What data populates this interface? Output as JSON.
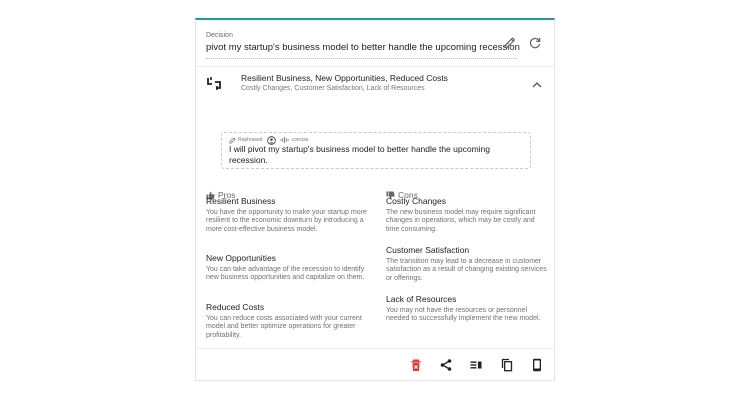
{
  "decision": {
    "label": "Decision",
    "value": "pivot my startup's business model to better handle the upcoming recession"
  },
  "summary": {
    "title": "Resilient Business, New Opportunities, Reduced Costs",
    "subtitle": "Costly Changes, Customer Satisfaction, Lack of Resources"
  },
  "rephrased": {
    "tag": "Rephrased",
    "style": "concise",
    "text": "I will pivot my startup's business model to better handle the upcoming recession."
  },
  "pros": {
    "heading": "Pros",
    "items": [
      {
        "title": "Resilient Business",
        "desc": "You have the opportunity to make your startup more resilient to the economic downturn by introducing a more cost-effective business model."
      },
      {
        "title": "New Opportunities",
        "desc": "You can take advantage of the recession to identify new business opportunities and capitalize on them."
      },
      {
        "title": "Reduced Costs",
        "desc": "You can reduce costs associated with your current model and better optimize operations for greater profitability."
      }
    ]
  },
  "cons": {
    "heading": "Cons",
    "items": [
      {
        "title": "Costly Changes",
        "desc": "The new business model may require significant changes in operations, which may be costly and time consuming."
      },
      {
        "title": "Customer Satisfaction",
        "desc": "The transition may lead to a decrease in customer satisfaction as a result of changing existing services or offerings."
      },
      {
        "title": "Lack of Resources",
        "desc": "You may not have the resources or personnel needed to successfully implement the new model."
      }
    ]
  },
  "icons": {
    "edit": "pencil-icon",
    "refresh": "refresh-icon",
    "scale": "scale-icon",
    "collapse": "chevron-up-icon",
    "pros": "thumbs-up-icon",
    "cons": "thumbs-down-icon",
    "toolbar": [
      "trash-icon",
      "share-icon",
      "list-icon",
      "copy-icon",
      "mobile-icon"
    ]
  },
  "colors": {
    "accent": "#1f9e8f",
    "delete": "#e53935"
  }
}
